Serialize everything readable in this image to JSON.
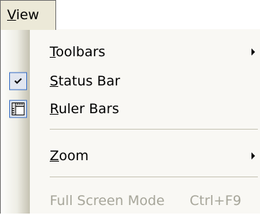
{
  "menubar": {
    "view_label": "View",
    "view_mnemonic": "V",
    "view_rest": "iew"
  },
  "menu": {
    "items": [
      {
        "id": "toolbars",
        "mnemonic": "T",
        "rest": "oolbars",
        "submenu": true,
        "icon": ""
      },
      {
        "id": "status-bar",
        "mnemonic": "S",
        "rest": "tatus Bar",
        "checked": true,
        "icon": "check-icon"
      },
      {
        "id": "ruler-bars",
        "mnemonic": "R",
        "rest": "uler Bars",
        "icon": "ruler-icon"
      },
      {
        "id": "zoom",
        "mnemonic": "Z",
        "rest": "oom",
        "submenu": true,
        "icon": ""
      },
      {
        "id": "full-screen-mode",
        "label": "Full Screen Mode",
        "shortcut": "Ctrl+F9",
        "disabled": true,
        "icon": ""
      }
    ]
  },
  "colors": {
    "menubar_bg": "#ece9d8",
    "highlight_border": "#316ac5",
    "disabled_text": "#a7a69a"
  }
}
